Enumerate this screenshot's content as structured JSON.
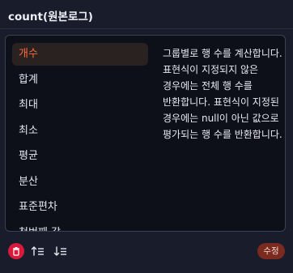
{
  "header": {
    "title": "count(원본로그)"
  },
  "functions": {
    "items": [
      {
        "label": "개수",
        "active": true
      },
      {
        "label": "합계",
        "active": false
      },
      {
        "label": "최대",
        "active": false
      },
      {
        "label": "최소",
        "active": false
      },
      {
        "label": "평균",
        "active": false
      },
      {
        "label": "분산",
        "active": false
      },
      {
        "label": "표준편차",
        "active": false
      },
      {
        "label": "첫번째 값",
        "active": false
      }
    ]
  },
  "description": {
    "text": "그룹별로 행 수를 계산합니다. 표현식이 지정되지 않은 경우에는 전체 행 수를 반환합니다. 표현식이 지정된 경우에는 null이 아닌 값으로 평가되는 행 수를 반환합니다."
  },
  "toolbar": {
    "delete_icon": "trash-icon",
    "sort_asc_icon": "sort-ascending-icon",
    "sort_desc_icon": "sort-descending-icon",
    "edit_label": "수정"
  },
  "colors": {
    "accent": "#ff6a3d",
    "active_item_bg": "#2a2220",
    "delete_button": "#d81b3c",
    "edit_button": "#7a2a1e"
  }
}
